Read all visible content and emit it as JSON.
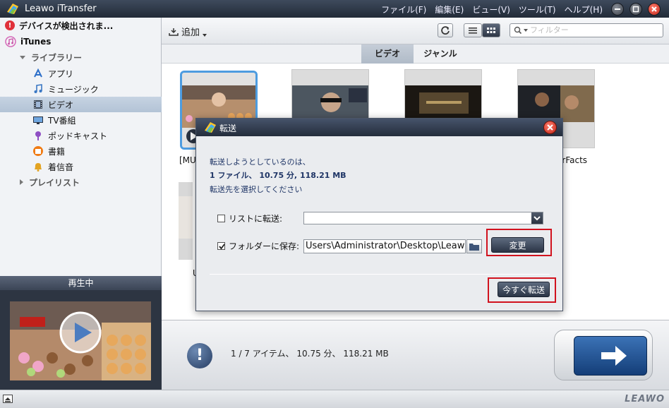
{
  "window": {
    "title": "Leawo iTransfer",
    "menu": [
      "ファイル(F)",
      "編集(E)",
      "ビュー(V)",
      "ツール(T)",
      "ヘルプ(H)"
    ]
  },
  "sidebar": {
    "device_warning": "デバイスが検出されま...",
    "itunes": "iTunes",
    "library": "ライブラリー",
    "items": [
      {
        "label": "アプリ",
        "icon": "app-store-icon"
      },
      {
        "label": "ミュージック",
        "icon": "music-note-icon"
      },
      {
        "label": "ビデオ",
        "icon": "film-icon",
        "selected": true
      },
      {
        "label": "TV番組",
        "icon": "monitor-icon"
      },
      {
        "label": "ポッドキャスト",
        "icon": "podcast-icon"
      },
      {
        "label": "書籍",
        "icon": "book-icon"
      },
      {
        "label": "着信音",
        "icon": "bell-icon"
      }
    ],
    "playlist": "プレイリスト",
    "now_playing": "再生中"
  },
  "toolbar": {
    "add_label": "追加",
    "search_placeholder": "フィルター"
  },
  "tabs": [
    "ビデオ",
    "ジャンル"
  ],
  "videos": [
    {
      "label": "[MU"
    },
    {
      "label": ""
    },
    {
      "label": ""
    },
    {
      "label": "erFacts"
    },
    {
      "label": "U"
    }
  ],
  "status": {
    "summary": "1 / 7 アイテム、 10.75 分、 118.21 MB"
  },
  "dialog": {
    "title": "転送",
    "line1": "転送しようとしているのは、",
    "line2": "1 ファイル、 10.75 分, 118.21 MB",
    "line3": "転送先を選択してください",
    "to_list_label": "リストに転送:",
    "to_list_checked": false,
    "to_list_value": "",
    "save_folder_label": "フォルダーに保存:",
    "save_folder_checked": true,
    "save_folder_path": "Users\\Administrator\\Desktop\\Leawo",
    "change_button": "変更",
    "transfer_now_button": "今すぐ転送"
  },
  "brand": "LEAWO",
  "colors": {
    "accent": "#1f3566",
    "highlight_frame": "#d1121e",
    "selection": "#4d9ce0"
  }
}
